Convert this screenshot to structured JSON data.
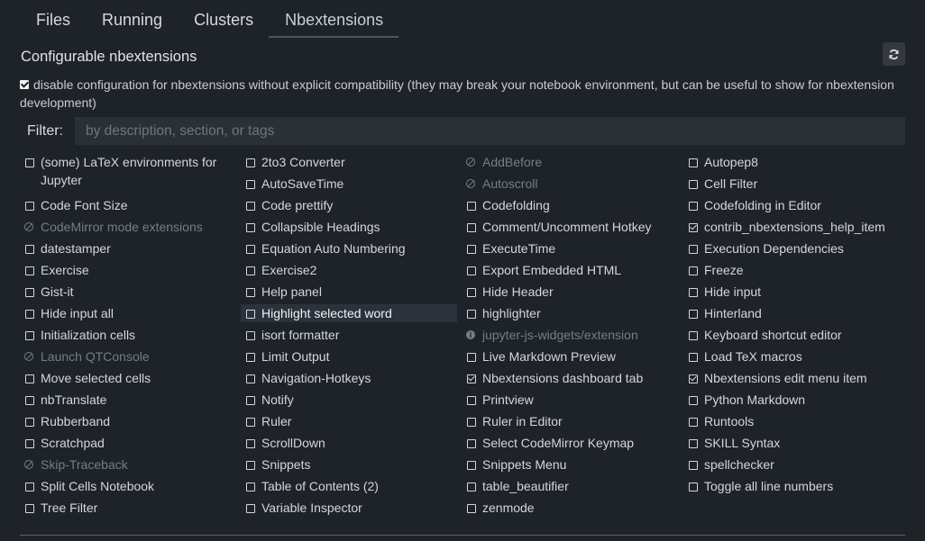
{
  "tabs": [
    {
      "label": "Files"
    },
    {
      "label": "Running"
    },
    {
      "label": "Clusters"
    },
    {
      "label": "Nbextensions",
      "active": true
    }
  ],
  "header": {
    "title": "Configurable nbextensions",
    "refresh_icon": "refresh-icon"
  },
  "compat": {
    "checked": true,
    "label": "disable configuration for nbextensions without explicit compatibility (they may break your notebook environment, but can be useful to show for nbextension development)"
  },
  "filter": {
    "label": "Filter:",
    "placeholder": "by description, section, or tags",
    "value": ""
  },
  "extensions": [
    [
      {
        "label": "(some) LaTeX environments for Jupyter",
        "state": "unchecked"
      },
      {
        "label": "Code Font Size",
        "state": "unchecked"
      },
      {
        "label": "CodeMirror mode extensions",
        "state": "disabled"
      },
      {
        "label": "datestamper",
        "state": "unchecked"
      },
      {
        "label": "Exercise",
        "state": "unchecked"
      },
      {
        "label": "Gist-it",
        "state": "unchecked"
      },
      {
        "label": "Hide input all",
        "state": "unchecked"
      },
      {
        "label": "Initialization cells",
        "state": "unchecked"
      },
      {
        "label": "Launch QTConsole",
        "state": "disabled"
      },
      {
        "label": "Move selected cells",
        "state": "unchecked"
      },
      {
        "label": "nbTranslate",
        "state": "unchecked"
      },
      {
        "label": "Rubberband",
        "state": "unchecked"
      },
      {
        "label": "Scratchpad",
        "state": "unchecked"
      },
      {
        "label": "Skip-Traceback",
        "state": "disabled"
      },
      {
        "label": "Split Cells Notebook",
        "state": "unchecked"
      },
      {
        "label": "Tree Filter",
        "state": "unchecked"
      }
    ],
    [
      {
        "label": "2to3 Converter",
        "state": "unchecked"
      },
      {
        "label": "AutoSaveTime",
        "state": "unchecked"
      },
      {
        "label": "Code prettify",
        "state": "unchecked"
      },
      {
        "label": "Collapsible Headings",
        "state": "unchecked"
      },
      {
        "label": "Equation Auto Numbering",
        "state": "unchecked"
      },
      {
        "label": "Exercise2",
        "state": "unchecked"
      },
      {
        "label": "Help panel",
        "state": "unchecked"
      },
      {
        "label": "Highlight selected word",
        "state": "unchecked",
        "highlight": true
      },
      {
        "label": "isort formatter",
        "state": "unchecked"
      },
      {
        "label": "Limit Output",
        "state": "unchecked"
      },
      {
        "label": "Navigation-Hotkeys",
        "state": "unchecked"
      },
      {
        "label": "Notify",
        "state": "unchecked"
      },
      {
        "label": "Ruler",
        "state": "unchecked"
      },
      {
        "label": "ScrollDown",
        "state": "unchecked"
      },
      {
        "label": "Snippets",
        "state": "unchecked"
      },
      {
        "label": "Table of Contents (2)",
        "state": "unchecked"
      },
      {
        "label": "Variable Inspector",
        "state": "unchecked"
      }
    ],
    [
      {
        "label": "AddBefore",
        "state": "disabled"
      },
      {
        "label": "Autoscroll",
        "state": "disabled"
      },
      {
        "label": "Codefolding",
        "state": "unchecked"
      },
      {
        "label": "Comment/Uncomment Hotkey",
        "state": "unchecked"
      },
      {
        "label": "ExecuteTime",
        "state": "unchecked"
      },
      {
        "label": "Export Embedded HTML",
        "state": "unchecked"
      },
      {
        "label": "Hide Header",
        "state": "unchecked"
      },
      {
        "label": "highlighter",
        "state": "unchecked"
      },
      {
        "label": "jupyter-js-widgets/extension",
        "state": "info"
      },
      {
        "label": "Live Markdown Preview",
        "state": "unchecked"
      },
      {
        "label": "Nbextensions dashboard tab",
        "state": "checked"
      },
      {
        "label": "Printview",
        "state": "unchecked"
      },
      {
        "label": "Ruler in Editor",
        "state": "unchecked"
      },
      {
        "label": "Select CodeMirror Keymap",
        "state": "unchecked"
      },
      {
        "label": "Snippets Menu",
        "state": "unchecked"
      },
      {
        "label": "table_beautifier",
        "state": "unchecked"
      },
      {
        "label": "zenmode",
        "state": "unchecked"
      }
    ],
    [
      {
        "label": "Autopep8",
        "state": "unchecked"
      },
      {
        "label": "Cell Filter",
        "state": "unchecked"
      },
      {
        "label": "Codefolding in Editor",
        "state": "unchecked"
      },
      {
        "label": "contrib_nbextensions_help_item",
        "state": "checked"
      },
      {
        "label": "Execution Dependencies",
        "state": "unchecked"
      },
      {
        "label": "Freeze",
        "state": "unchecked"
      },
      {
        "label": "Hide input",
        "state": "unchecked"
      },
      {
        "label": "Hinterland",
        "state": "unchecked"
      },
      {
        "label": "Keyboard shortcut editor",
        "state": "unchecked"
      },
      {
        "label": "Load TeX macros",
        "state": "unchecked"
      },
      {
        "label": "Nbextensions edit menu item",
        "state": "checked"
      },
      {
        "label": "Python Markdown",
        "state": "unchecked"
      },
      {
        "label": "Runtools",
        "state": "unchecked"
      },
      {
        "label": "SKILL Syntax",
        "state": "unchecked"
      },
      {
        "label": "spellchecker",
        "state": "unchecked"
      },
      {
        "label": "Toggle all line numbers",
        "state": "unchecked"
      }
    ]
  ]
}
